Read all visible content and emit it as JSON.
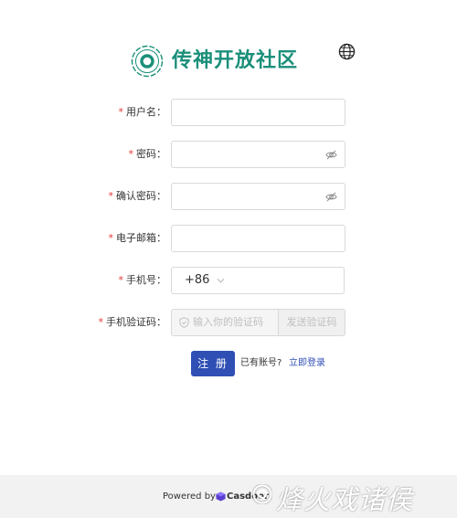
{
  "app": {
    "title": "传神开放社区"
  },
  "language_icon": "globe-icon",
  "form": {
    "username": {
      "required_mark": "*",
      "label": "用户名："
    },
    "password": {
      "required_mark": "*",
      "label": "密码："
    },
    "confirm_password": {
      "required_mark": "*",
      "label": "确认密码："
    },
    "email": {
      "required_mark": "*",
      "label": "电子邮箱："
    },
    "phone": {
      "required_mark": "*",
      "label": "手机号：",
      "country_code": "+86"
    },
    "phone_code": {
      "required_mark": "*",
      "label": "手机验证码：",
      "placeholder": "输入你的验证码",
      "send_button": "发送验证码"
    }
  },
  "actions": {
    "submit": "注 册",
    "have_account": "已有账号?",
    "login_link": "立即登录"
  },
  "footer": {
    "powered_by": "Powered by",
    "brand": "Casdoor",
    "watermark": "烽火戏诸侯"
  },
  "colors": {
    "brand": "#1b8f7a",
    "primary": "#2f4fb5",
    "required": "#e53935"
  }
}
